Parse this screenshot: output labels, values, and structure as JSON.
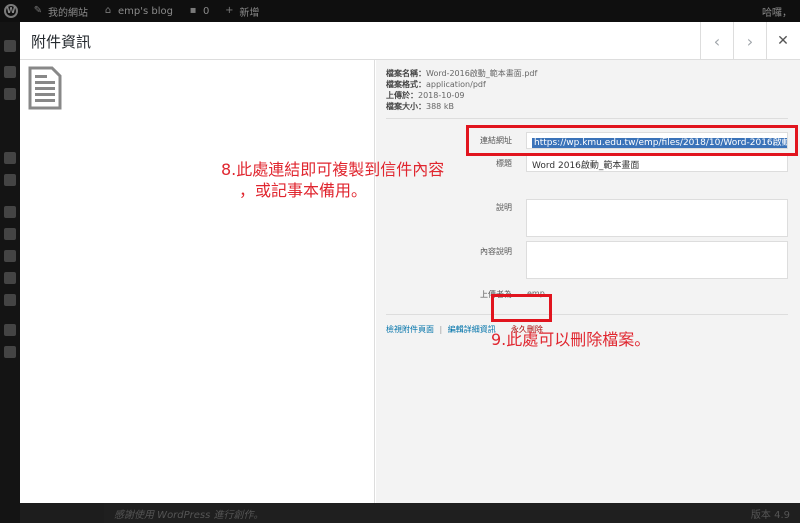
{
  "adminbar": {
    "my_site": "我的網站",
    "blog": "emp's blog",
    "comments": "0",
    "new": "新增",
    "greeting": "哈囉，"
  },
  "modal": {
    "title": "附件資訊",
    "prev_glyph": "‹",
    "next_glyph": "›",
    "close_glyph": "✕"
  },
  "details": {
    "filename_label": "檔案名稱：",
    "filename": "Word-2016啟動_範本畫面.pdf",
    "filetype_label": "檔案格式：",
    "filetype": "application/pdf",
    "uploaded_label": "上傳於：",
    "uploaded": "2018-10-09",
    "filesize_label": "檔案大小：",
    "filesize": "388 kB"
  },
  "fields": {
    "url_label": "連結網址",
    "url": "https://wp.kmu.edu.tw/emp/files/2018/10/Word-2016啟動",
    "title_label": "標題",
    "title": "Word 2016啟動_範本畫面",
    "caption_label": "說明",
    "description_label": "內容說明",
    "uploader_label": "上傳者為",
    "uploader": "emp"
  },
  "actions": {
    "view": "檢視附件頁面",
    "separator": "|",
    "edit": "編輯詳細資訊",
    "delete": "永久刪除"
  },
  "annotations": {
    "note1_line1": "8.此處連結即可複製到信件內容",
    "note1_line2": "，或記事本備用。",
    "note2": "9.此處可以刪除檔案。",
    "color": "#e1141e"
  },
  "footer": {
    "thanks": "感謝使用 WordPress 進行創作。",
    "version": "版本 4.9"
  }
}
